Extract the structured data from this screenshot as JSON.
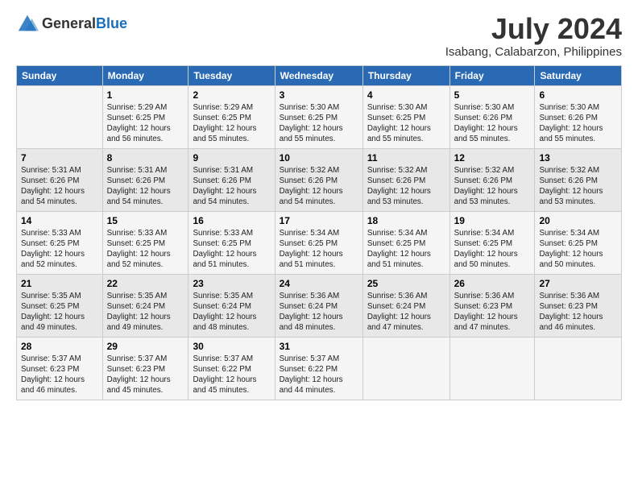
{
  "header": {
    "logo_general": "General",
    "logo_blue": "Blue",
    "title": "July 2024",
    "subtitle": "Isabang, Calabarzon, Philippines"
  },
  "days_of_week": [
    "Sunday",
    "Monday",
    "Tuesday",
    "Wednesday",
    "Thursday",
    "Friday",
    "Saturday"
  ],
  "weeks": [
    [
      {
        "day": "",
        "content": ""
      },
      {
        "day": "1",
        "content": "Sunrise: 5:29 AM\nSunset: 6:25 PM\nDaylight: 12 hours\nand 56 minutes."
      },
      {
        "day": "2",
        "content": "Sunrise: 5:29 AM\nSunset: 6:25 PM\nDaylight: 12 hours\nand 55 minutes."
      },
      {
        "day": "3",
        "content": "Sunrise: 5:30 AM\nSunset: 6:25 PM\nDaylight: 12 hours\nand 55 minutes."
      },
      {
        "day": "4",
        "content": "Sunrise: 5:30 AM\nSunset: 6:25 PM\nDaylight: 12 hours\nand 55 minutes."
      },
      {
        "day": "5",
        "content": "Sunrise: 5:30 AM\nSunset: 6:26 PM\nDaylight: 12 hours\nand 55 minutes."
      },
      {
        "day": "6",
        "content": "Sunrise: 5:30 AM\nSunset: 6:26 PM\nDaylight: 12 hours\nand 55 minutes."
      }
    ],
    [
      {
        "day": "7",
        "content": "Sunrise: 5:31 AM\nSunset: 6:26 PM\nDaylight: 12 hours\nand 54 minutes."
      },
      {
        "day": "8",
        "content": "Sunrise: 5:31 AM\nSunset: 6:26 PM\nDaylight: 12 hours\nand 54 minutes."
      },
      {
        "day": "9",
        "content": "Sunrise: 5:31 AM\nSunset: 6:26 PM\nDaylight: 12 hours\nand 54 minutes."
      },
      {
        "day": "10",
        "content": "Sunrise: 5:32 AM\nSunset: 6:26 PM\nDaylight: 12 hours\nand 54 minutes."
      },
      {
        "day": "11",
        "content": "Sunrise: 5:32 AM\nSunset: 6:26 PM\nDaylight: 12 hours\nand 53 minutes."
      },
      {
        "day": "12",
        "content": "Sunrise: 5:32 AM\nSunset: 6:26 PM\nDaylight: 12 hours\nand 53 minutes."
      },
      {
        "day": "13",
        "content": "Sunrise: 5:32 AM\nSunset: 6:26 PM\nDaylight: 12 hours\nand 53 minutes."
      }
    ],
    [
      {
        "day": "14",
        "content": "Sunrise: 5:33 AM\nSunset: 6:25 PM\nDaylight: 12 hours\nand 52 minutes."
      },
      {
        "day": "15",
        "content": "Sunrise: 5:33 AM\nSunset: 6:25 PM\nDaylight: 12 hours\nand 52 minutes."
      },
      {
        "day": "16",
        "content": "Sunrise: 5:33 AM\nSunset: 6:25 PM\nDaylight: 12 hours\nand 51 minutes."
      },
      {
        "day": "17",
        "content": "Sunrise: 5:34 AM\nSunset: 6:25 PM\nDaylight: 12 hours\nand 51 minutes."
      },
      {
        "day": "18",
        "content": "Sunrise: 5:34 AM\nSunset: 6:25 PM\nDaylight: 12 hours\nand 51 minutes."
      },
      {
        "day": "19",
        "content": "Sunrise: 5:34 AM\nSunset: 6:25 PM\nDaylight: 12 hours\nand 50 minutes."
      },
      {
        "day": "20",
        "content": "Sunrise: 5:34 AM\nSunset: 6:25 PM\nDaylight: 12 hours\nand 50 minutes."
      }
    ],
    [
      {
        "day": "21",
        "content": "Sunrise: 5:35 AM\nSunset: 6:25 PM\nDaylight: 12 hours\nand 49 minutes."
      },
      {
        "day": "22",
        "content": "Sunrise: 5:35 AM\nSunset: 6:24 PM\nDaylight: 12 hours\nand 49 minutes."
      },
      {
        "day": "23",
        "content": "Sunrise: 5:35 AM\nSunset: 6:24 PM\nDaylight: 12 hours\nand 48 minutes."
      },
      {
        "day": "24",
        "content": "Sunrise: 5:36 AM\nSunset: 6:24 PM\nDaylight: 12 hours\nand 48 minutes."
      },
      {
        "day": "25",
        "content": "Sunrise: 5:36 AM\nSunset: 6:24 PM\nDaylight: 12 hours\nand 47 minutes."
      },
      {
        "day": "26",
        "content": "Sunrise: 5:36 AM\nSunset: 6:23 PM\nDaylight: 12 hours\nand 47 minutes."
      },
      {
        "day": "27",
        "content": "Sunrise: 5:36 AM\nSunset: 6:23 PM\nDaylight: 12 hours\nand 46 minutes."
      }
    ],
    [
      {
        "day": "28",
        "content": "Sunrise: 5:37 AM\nSunset: 6:23 PM\nDaylight: 12 hours\nand 46 minutes."
      },
      {
        "day": "29",
        "content": "Sunrise: 5:37 AM\nSunset: 6:23 PM\nDaylight: 12 hours\nand 45 minutes."
      },
      {
        "day": "30",
        "content": "Sunrise: 5:37 AM\nSunset: 6:22 PM\nDaylight: 12 hours\nand 45 minutes."
      },
      {
        "day": "31",
        "content": "Sunrise: 5:37 AM\nSunset: 6:22 PM\nDaylight: 12 hours\nand 44 minutes."
      },
      {
        "day": "",
        "content": ""
      },
      {
        "day": "",
        "content": ""
      },
      {
        "day": "",
        "content": ""
      }
    ]
  ]
}
